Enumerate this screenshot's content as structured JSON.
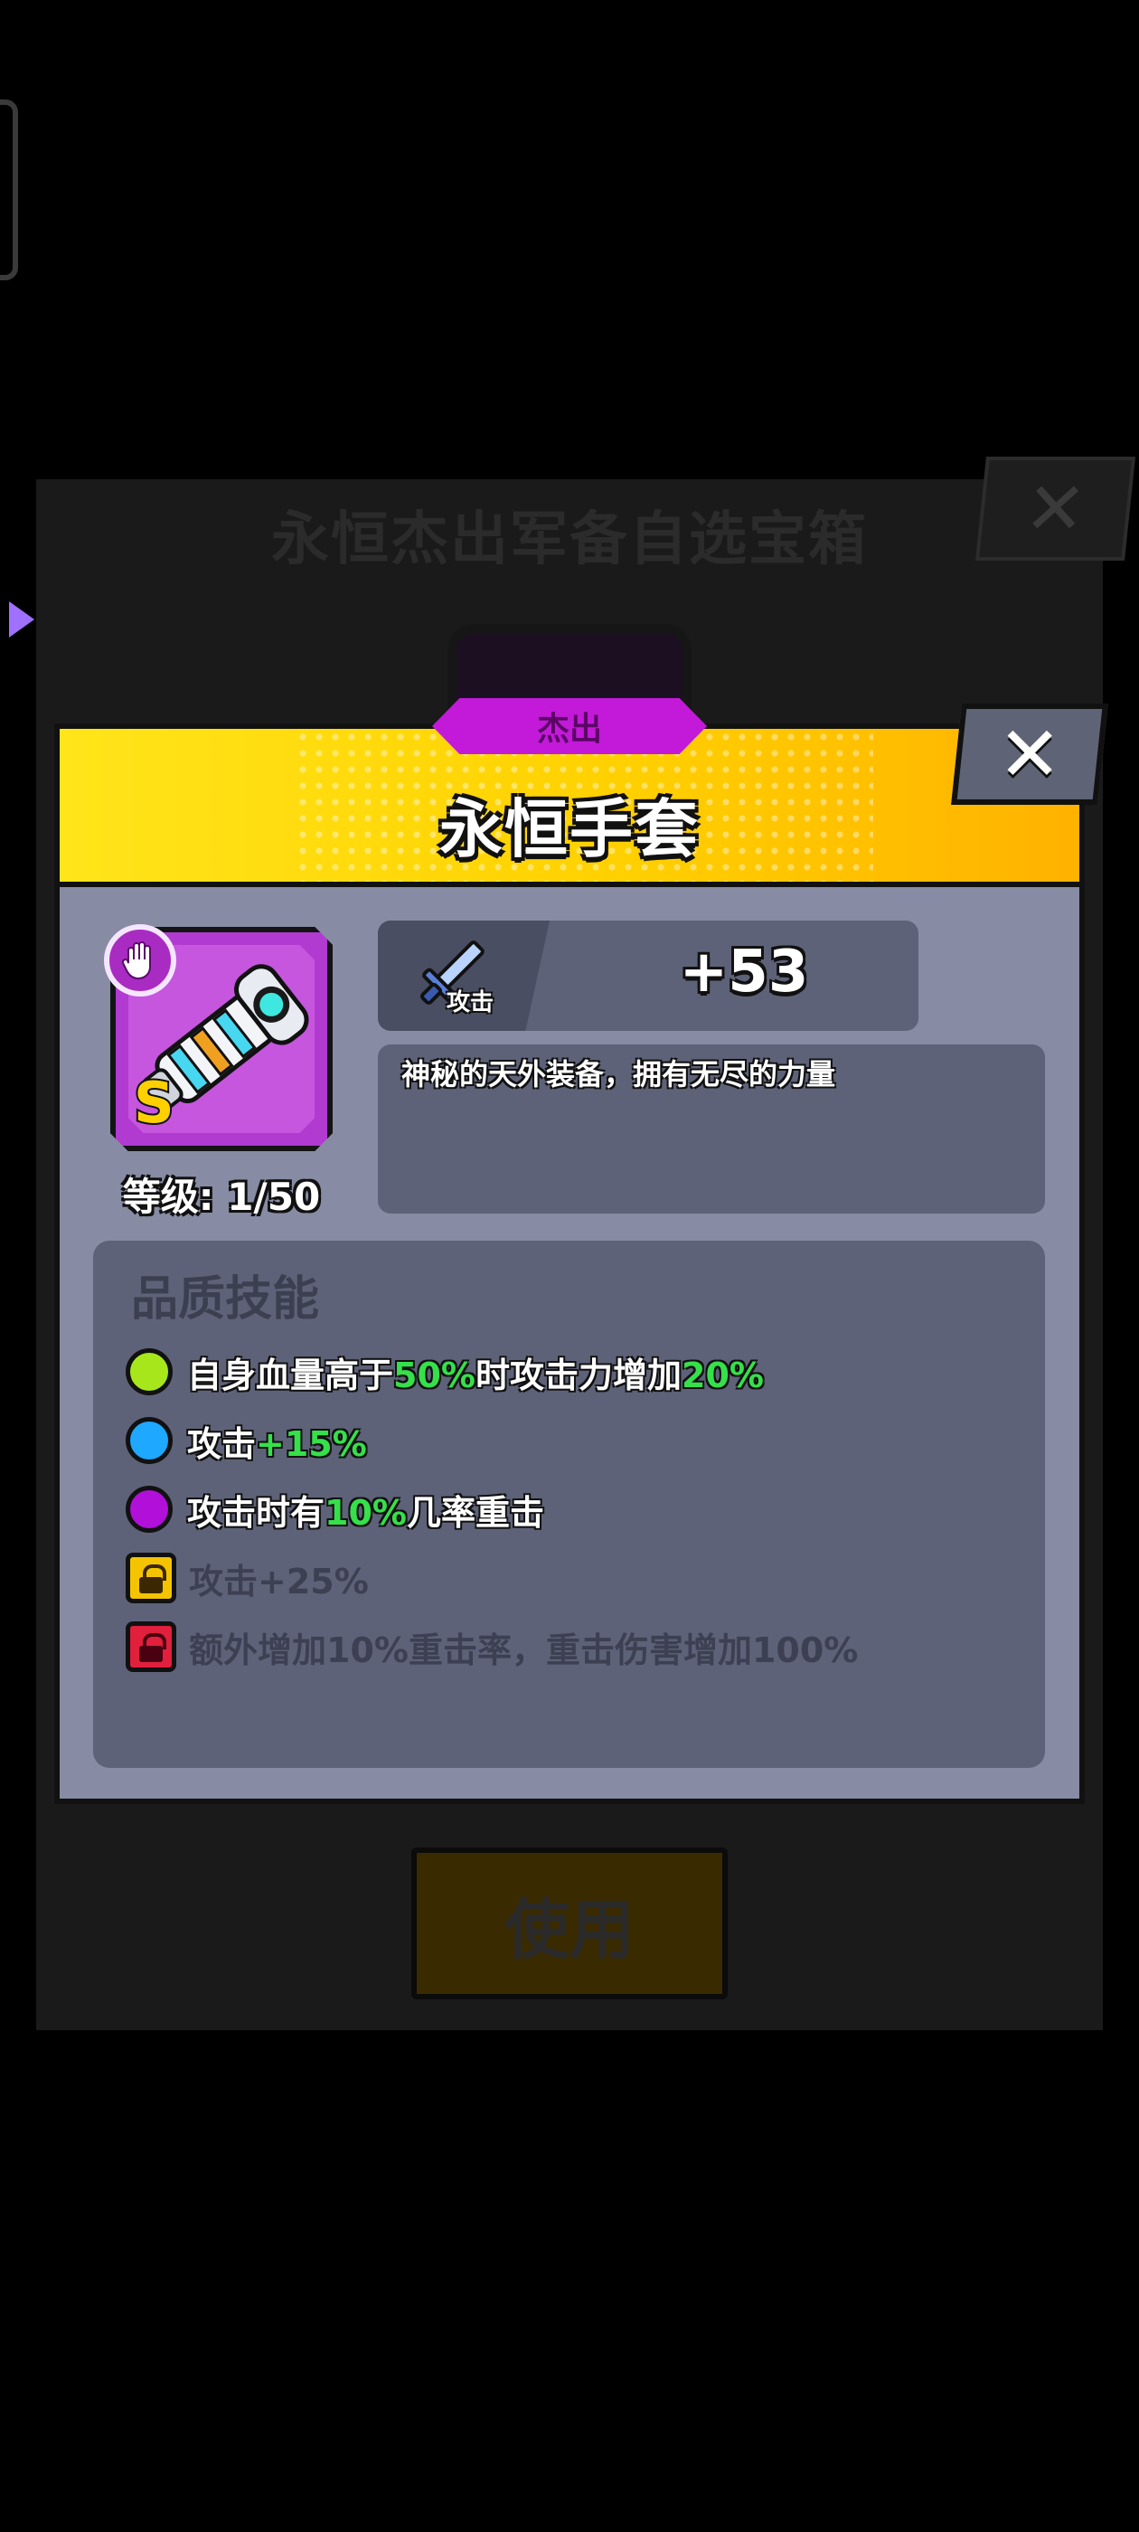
{
  "background": {
    "chest_title": "永恒杰出军备自选宝箱",
    "close_label": "✕",
    "use_button": "使用"
  },
  "card": {
    "rarity": "杰出",
    "item_name": "永恒手套",
    "close_label": "✕",
    "item_grade": "S",
    "level_text": "等级: 1/50",
    "stat": {
      "label": "攻击",
      "value": "+53"
    },
    "description": "神秘的天外装备，拥有无尽的力量",
    "skills_title": "品质技能",
    "skills": [
      {
        "parts": [
          "自身血量高于",
          "50%",
          "时攻击力增加",
          "20%"
        ],
        "bullet_color": "#a8e61c",
        "locked": false
      },
      {
        "parts": [
          "攻击",
          "+15%"
        ],
        "bullet_color": "#1ea8ff",
        "locked": false
      },
      {
        "parts": [
          "攻击时有",
          "10%",
          "几率重击"
        ],
        "bullet_color": "#b010d8",
        "locked": false
      },
      {
        "text": "攻击+25%",
        "lock_color": "#f5c400",
        "locked": true
      },
      {
        "text": "额外增加10%重击率，重击伤害增加100%",
        "lock_color": "#e0203c",
        "locked": true
      }
    ]
  },
  "colors": {
    "header_yellow": "#ffd000",
    "rarity_purple": "#c21ad8",
    "highlight_green": "#35e04a"
  }
}
